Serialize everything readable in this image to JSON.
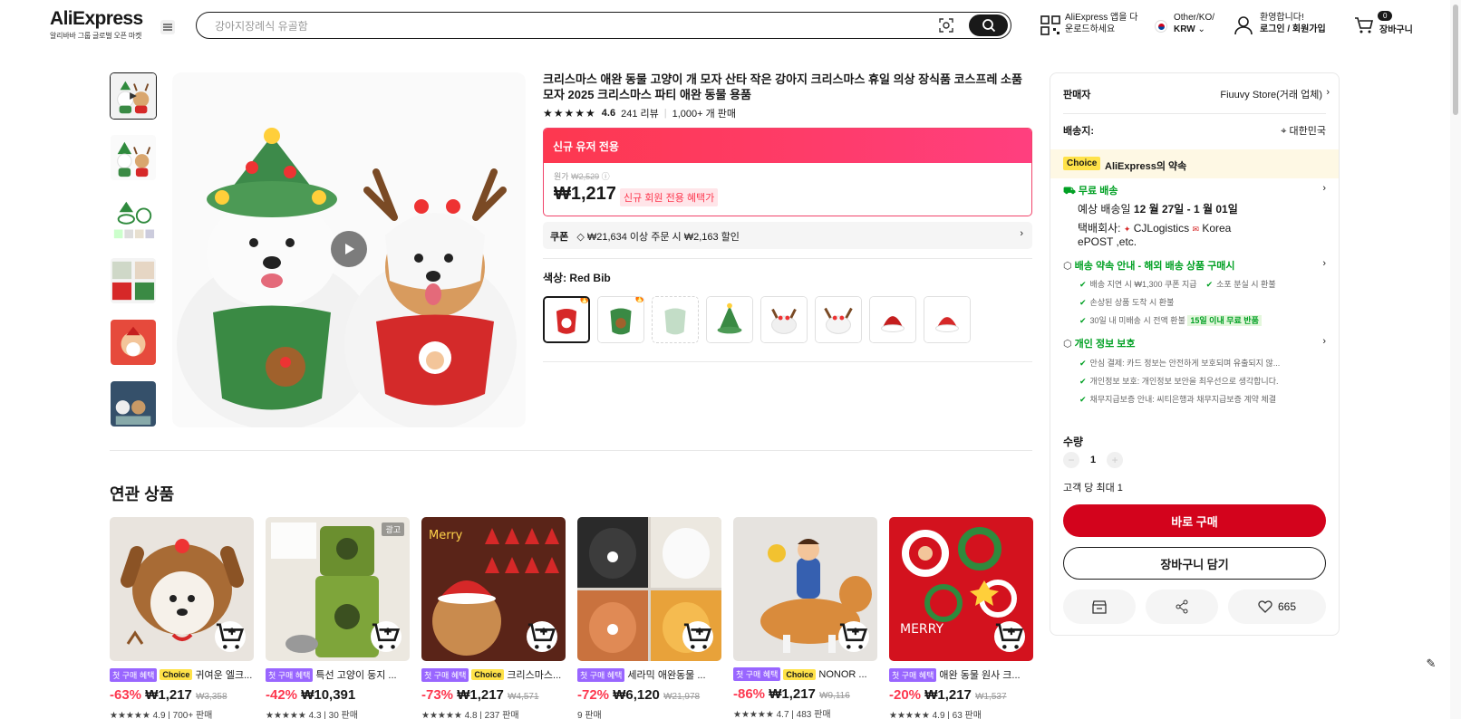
{
  "header": {
    "logo": "AliExpress",
    "logo_sub": "알리바바 그룹 글로벌 오픈 마켓",
    "search_placeholder": "강아지장례식 유골함",
    "app_line1": "AliExpress 앱을 다",
    "app_line2": "운로드하세요",
    "region_line1": "Other/KO/",
    "region_line2": "KRW",
    "account_line1": "환영합니다!",
    "account_line2": "로그인 / 회원가입",
    "cart_count": "0",
    "cart_label": "장바구니"
  },
  "product": {
    "title": "크리스마스 애완 동물 고양이 개 모자 산타 작은 강아지 크리스마스 휴일 의상 장식품 코스프레 소품 모자 2025 크리스마스 파티 애완 동물 용품",
    "stars": "★★★★★",
    "rating": "4.6",
    "reviews": "241 리뷰",
    "sold": "1,000+ 개 판매",
    "promo_header": "신규 유저 전용",
    "orig_label": "원가",
    "orig_price": "₩2,529",
    "price": "₩1,217",
    "price_tag": "신규 회원 전용 혜택가",
    "coupon_label": "쿠폰",
    "coupon_text": "₩21,634 이상 주문 시 ₩2,163 할인",
    "color_label": "색상: Red Bib"
  },
  "panel": {
    "seller_label": "판매자",
    "seller_name": "Fiuuvy Store(거래 업체)",
    "ship_label": "배송지:",
    "ship_to": "대한민국",
    "choice_badge": "Choice",
    "choice_text": "AliExpress의 약속",
    "free_ship": "무료 배송",
    "est_delivery_prefix": "예상 배송일",
    "est_delivery": "12 월 27일 - 1 월 01일",
    "carrier_label": "택배회사:",
    "carrier1": "CJLogistics",
    "carrier2": "Korea",
    "carrier3": "ePOST ,etc.",
    "guarantee_title": "배송 약속 안내 - 해외 배송 상품 구매시",
    "g1": "배송 지연 시 ₩1,300 쿠폰 지급",
    "g2": "소포 분실 시 환불",
    "g3": "손상된 상품 도착 시 환불",
    "g4": "30일 내 미배송 시 전액 환불",
    "g4_badge": "15일 이내 무료 반품",
    "privacy_title": "개인 정보 보호",
    "p1": "안심 결제: 카드 정보는 안전하게 보호되며 유출되지 않...",
    "p2": "개인정보 보호: 개인정보 보안을 최우선으로 생각합니다.",
    "p3": "채무지급보증 안내: 씨티은행과 채무지급보증 계약 체결",
    "qty_label": "수량",
    "qty_value": "1",
    "qty_limit": "고객 당 최대 1",
    "buy_now": "바로 구매",
    "add_cart": "장바구니 담기",
    "wish_count": "665"
  },
  "related": {
    "title": "연관 상품",
    "first_tag": "첫 구매 혜택",
    "choice_tag": "Choice",
    "ad_tag": "광고",
    "items": [
      {
        "title": "귀여운 엘크...",
        "choice": true,
        "disc": "-63%",
        "price": "₩1,217",
        "orig": "₩3,358",
        "meta": "★★★★★ 4.9 | 700+ 판매"
      },
      {
        "title": "특선 고양이 둥지 ...",
        "choice": false,
        "disc": "-42%",
        "price": "₩10,391",
        "orig": "",
        "meta": "★★★★★ 4.3 | 30 판매"
      },
      {
        "title": "크리스마스...",
        "choice": true,
        "disc": "-73%",
        "price": "₩1,217",
        "orig": "₩4,571",
        "meta": "★★★★★ 4.8 | 237 판매"
      },
      {
        "title": "세라믹 애완동물 ...",
        "choice": false,
        "disc": "-72%",
        "price": "₩6,120",
        "orig": "₩21,978",
        "meta": "9 판매"
      },
      {
        "title": "NONOR ...",
        "choice": true,
        "disc": "-86%",
        "price": "₩1,217",
        "orig": "₩9,116",
        "meta": "★★★★★ 4.7 | 483 판매"
      },
      {
        "title": "애완 동물 원사 크...",
        "choice": false,
        "disc": "-20%",
        "price": "₩1,217",
        "orig": "₩1,537",
        "meta": "★★★★★ 4.9 | 63 판매"
      }
    ]
  },
  "colors": {
    "brand_red": "#d3031c",
    "promo_pink": "#fd384f",
    "green": "#00a023",
    "choice_yellow": "#ffe248"
  }
}
